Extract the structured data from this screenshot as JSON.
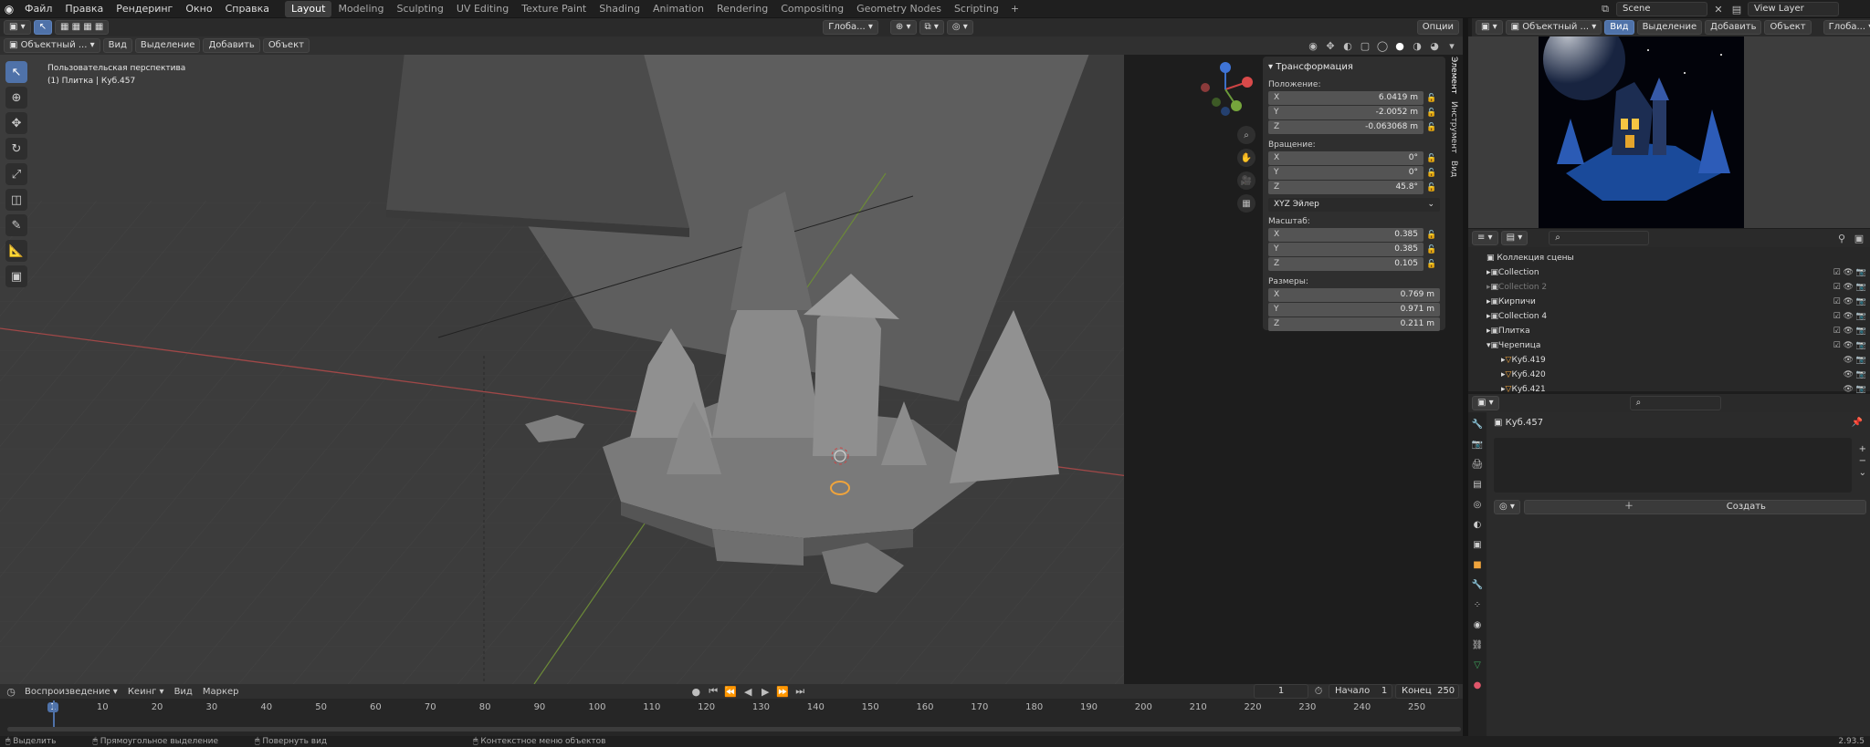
{
  "topbar": {
    "menus": [
      "Файл",
      "Правка",
      "Рендеринг",
      "Окно",
      "Справка"
    ],
    "workspaces": [
      "Layout",
      "Modeling",
      "Sculpting",
      "UV Editing",
      "Texture Paint",
      "Shading",
      "Animation",
      "Rendering",
      "Compositing",
      "Geometry Nodes",
      "Scripting"
    ],
    "active_workspace": "Layout",
    "scene": "Scene",
    "view_layer": "View Layer"
  },
  "view3d_header": {
    "mode": "Объектный ...",
    "menus": [
      "Вид",
      "Выделение",
      "Добавить",
      "Объект"
    ],
    "orientation": "Глоба...",
    "options": "Опции"
  },
  "viewport": {
    "perspective": "Пользовательская перспектива",
    "active_object": "(1) Плитка | Куб.457"
  },
  "npanel": {
    "title": "Трансформация",
    "location_label": "Положение:",
    "location": [
      {
        "axis": "X",
        "value": "6.0419 m"
      },
      {
        "axis": "Y",
        "value": "-2.0052 m"
      },
      {
        "axis": "Z",
        "value": "-0.063068 m"
      }
    ],
    "rotation_label": "Вращение:",
    "rotation": [
      {
        "axis": "X",
        "value": "0°"
      },
      {
        "axis": "Y",
        "value": "0°"
      },
      {
        "axis": "Z",
        "value": "45.8°"
      }
    ],
    "rotation_mode": "XYZ Эйлер",
    "scale_label": "Масштаб:",
    "scale": [
      {
        "axis": "X",
        "value": "0.385"
      },
      {
        "axis": "Y",
        "value": "0.385"
      },
      {
        "axis": "Z",
        "value": "0.105"
      }
    ],
    "dimensions_label": "Размеры:",
    "dimensions": [
      {
        "axis": "X",
        "value": "0.769 m"
      },
      {
        "axis": "Y",
        "value": "0.971 m"
      },
      {
        "axis": "Z",
        "value": "0.211 m"
      }
    ],
    "tabs": [
      "Элемент",
      "Инструмент",
      "Вид"
    ]
  },
  "render_header": {
    "mode": "Объектный ...",
    "menus": [
      "Вид",
      "Выделение",
      "Добавить",
      "Объект"
    ],
    "orientation": "Глоба..."
  },
  "outliner": {
    "root": "Коллекция сцены",
    "items": [
      {
        "name": "Collection",
        "indent": 1,
        "dim": false
      },
      {
        "name": "Collection 2",
        "indent": 1,
        "dim": true
      },
      {
        "name": "Кирпичи",
        "indent": 1,
        "dim": false
      },
      {
        "name": "Collection 4",
        "indent": 1,
        "dim": false
      },
      {
        "name": "Плитка",
        "indent": 1,
        "dim": false
      },
      {
        "name": "Черепица",
        "indent": 1,
        "dim": false
      },
      {
        "name": "Куб.419",
        "indent": 2,
        "dim": false
      },
      {
        "name": "Куб.420",
        "indent": 2,
        "dim": false
      },
      {
        "name": "Куб.421",
        "indent": 2,
        "dim": false
      }
    ]
  },
  "properties": {
    "object_name": "Куб.457",
    "create_label": "Создать"
  },
  "timeline": {
    "menus": [
      "Воспроизведение",
      "Кеинг",
      "Вид",
      "Маркер"
    ],
    "current_frame": "1",
    "start_label": "Начало",
    "start": "1",
    "end_label": "Конец",
    "end": "250",
    "ticks": [
      "1",
      "10",
      "20",
      "30",
      "40",
      "50",
      "60",
      "70",
      "80",
      "90",
      "100",
      "110",
      "120",
      "130",
      "140",
      "150",
      "160",
      "170",
      "180",
      "190",
      "200",
      "210",
      "220",
      "230",
      "240",
      "250"
    ]
  },
  "status": {
    "select": "Выделить",
    "box_select": "Прямоугольное выделение",
    "rotate_view": "Повернуть вид",
    "context_menu": "Контекстное меню объектов",
    "version": "2.93.5"
  }
}
